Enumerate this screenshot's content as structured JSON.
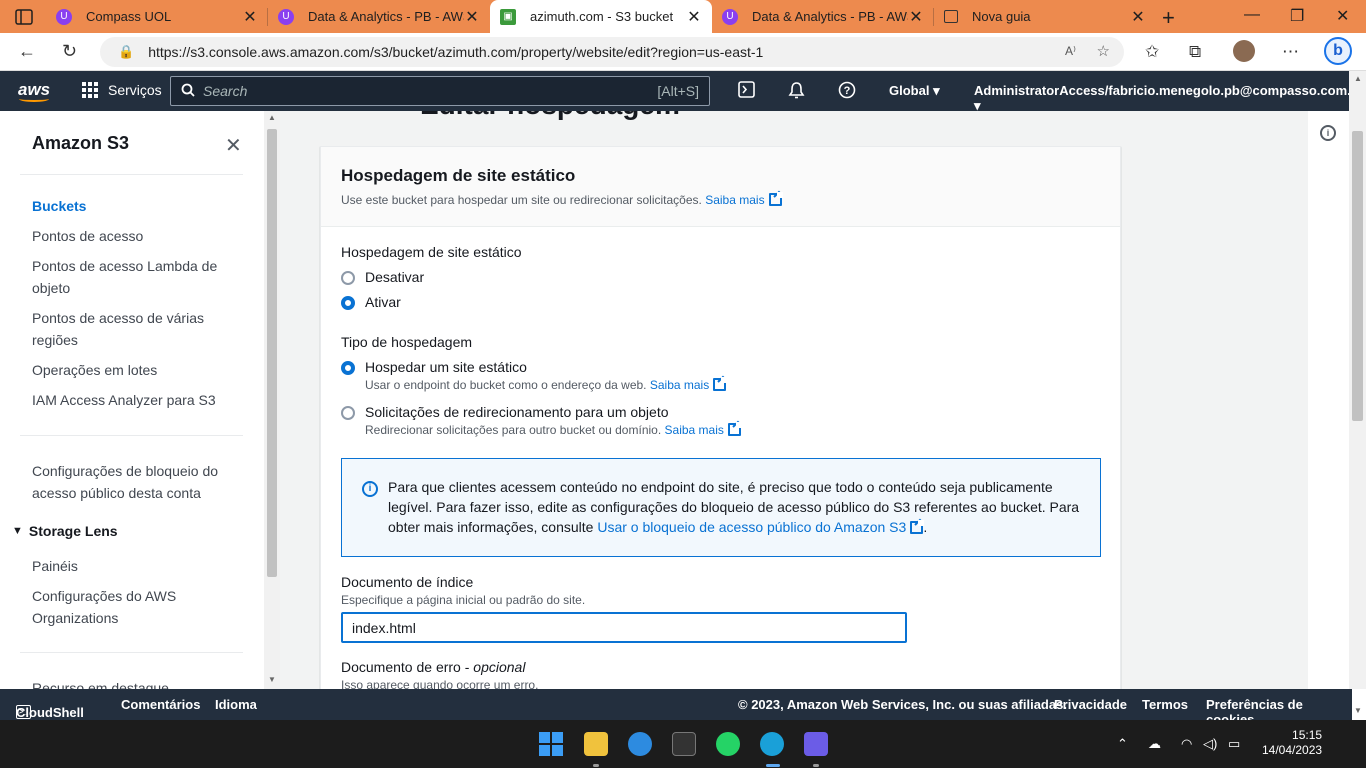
{
  "browser": {
    "tabs": [
      {
        "title": "Compass UOL",
        "icon": "compass-uol-favicon"
      },
      {
        "title": "Data & Analytics - PB - AWS",
        "icon": "compass-uol-favicon"
      },
      {
        "title": "azimuth.com - S3 bucket",
        "icon": "s3-favicon",
        "active": true
      },
      {
        "title": "Data & Analytics - PB - AWS",
        "icon": "compass-uol-favicon"
      },
      {
        "title": "Nova guia",
        "icon": "new-tab-favicon"
      }
    ],
    "url": "https://s3.console.aws.amazon.com/s3/bucket/azimuth.com/property/website/edit?region=us-east-1",
    "read_aloud": "A⁾"
  },
  "aws_header": {
    "logo": "aws",
    "services": "Serviços",
    "search_placeholder": "Search",
    "search_shortcut": "[Alt+S]",
    "region": "Global",
    "account": "AdministratorAccess/fabricio.menegolo.pb@compasso.com.br"
  },
  "sidebar": {
    "title": "Amazon S3",
    "items": [
      {
        "label": "Buckets",
        "active": true
      },
      {
        "label": "Pontos de acesso"
      },
      {
        "label": "Pontos de acesso Lambda de objeto"
      },
      {
        "label": "Pontos de acesso de várias regiões"
      },
      {
        "label": "Operações em lotes"
      },
      {
        "label": "IAM Access Analyzer para S3"
      },
      {
        "label": "Configurações de bloqueio do acesso público desta conta"
      },
      {
        "label": "Painéis"
      },
      {
        "label": "Configurações do AWS Organizations"
      },
      {
        "label": "Recurso em destaque"
      }
    ],
    "section": "Storage Lens"
  },
  "main": {
    "heading_peek": "Editar hospedagem",
    "panel": {
      "title": "Hospedagem de site estático",
      "description": "Use este bucket para hospedar um site ou redirecionar solicitações.",
      "learn_more": "Saiba mais",
      "hosting_label": "Hospedagem de site estático",
      "hosting_options": [
        "Desativar",
        "Ativar"
      ],
      "hosting_selected": "Ativar",
      "type_label": "Tipo de hospedagem",
      "type_options": [
        {
          "label": "Hospedar um site estático",
          "desc": "Usar o endpoint do bucket como o endereço da web.",
          "link": "Saiba mais",
          "selected": true
        },
        {
          "label": "Solicitações de redirecionamento para um objeto",
          "desc": "Redirecionar solicitações para outro bucket ou domínio.",
          "link": "Saiba mais",
          "selected": false
        }
      ],
      "info_text": "Para que clientes acessem conteúdo no endpoint do site, é preciso que todo o conteúdo seja publicamente legível. Para fazer isso, edite as configurações do bloqueio de acesso público do S3 referentes ao bucket. Para obter mais informações, consulte ",
      "info_link": "Usar o bloqueio de acesso público do Amazon S3",
      "info_end": ".",
      "index_label": "Documento de índice",
      "index_desc": "Especifique a página inicial ou padrão do site.",
      "index_value": "index.html",
      "error_label": "Documento de erro",
      "error_optional": "opcional",
      "error_sep": " - ",
      "error_desc": "Isso aparece quando ocorre um erro."
    }
  },
  "footer": {
    "cloudshell": "CloudShell",
    "comments": "Comentários",
    "language": "Idioma",
    "copyright": "© 2023, Amazon Web Services, Inc. ou suas afiliadas.",
    "privacy": "Privacidade",
    "terms": "Termos",
    "cookies": "Preferências de cookies"
  },
  "taskbar": {
    "time": "15:15",
    "date": "14/04/2023"
  }
}
